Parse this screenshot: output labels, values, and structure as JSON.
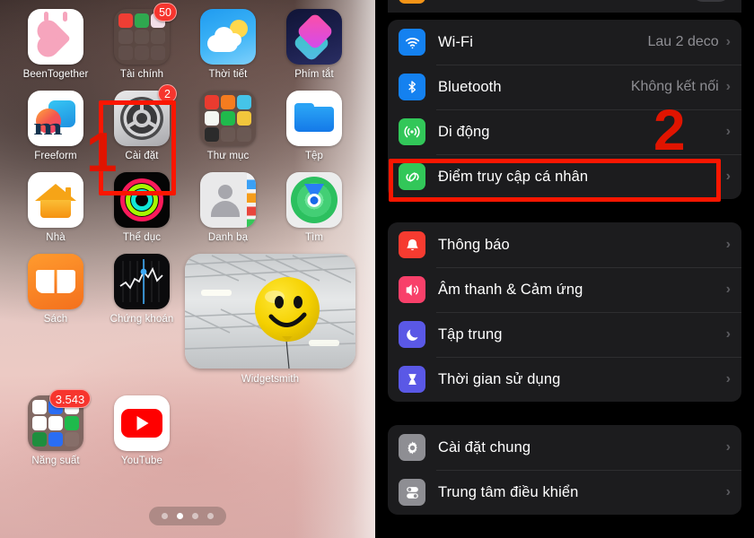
{
  "home_screen": {
    "page_dots": {
      "count": 4,
      "active_index": 1
    },
    "rows": [
      [
        {
          "label": "BeenTogether",
          "icon": "beentogether-icon",
          "badge": null
        },
        {
          "label": "Tài chính",
          "icon": "folder-finance-icon",
          "badge": "50"
        },
        {
          "label": "Thời tiết",
          "icon": "weather-icon",
          "badge": null
        },
        {
          "label": "Phím tắt",
          "icon": "shortcuts-icon",
          "badge": null
        }
      ],
      [
        {
          "label": "Freeform",
          "icon": "freeform-icon",
          "badge": null
        },
        {
          "label": "Cài đặt",
          "icon": "settings-gear-icon",
          "badge": "2"
        },
        {
          "label": "Thư mục",
          "icon": "folder-icon",
          "badge": null
        },
        {
          "label": "Tệp",
          "icon": "files-icon",
          "badge": null
        }
      ],
      [
        {
          "label": "Nhà",
          "icon": "home-app-icon",
          "badge": null
        },
        {
          "label": "Thể dục",
          "icon": "fitness-rings-icon",
          "badge": null
        },
        {
          "label": "Danh bạ",
          "icon": "contacts-icon",
          "badge": null
        },
        {
          "label": "Tìm",
          "icon": "find-my-icon",
          "badge": null
        }
      ],
      [
        {
          "label": "Sách",
          "icon": "books-icon",
          "badge": null
        },
        {
          "label": "Chứng khoán",
          "icon": "stocks-icon",
          "badge": null
        }
      ],
      [
        {
          "label": "Năng suất",
          "icon": "folder-productivity-icon",
          "badge": "3.543"
        },
        {
          "label": "YouTube",
          "icon": "youtube-icon",
          "badge": null
        }
      ]
    ],
    "widget": {
      "label": "Widgetsmith",
      "icon": "widgetsmith-photo-widget"
    }
  },
  "settings_screen": {
    "partial_top_row": {
      "label": "",
      "icon": "airplane-mode-icon",
      "toggle": "off"
    },
    "group1": [
      {
        "label": "Wi-Fi",
        "value": "Lau 2 deco",
        "icon": "wifi-icon",
        "chevron": "›",
        "highlighted": false
      },
      {
        "label": "Bluetooth",
        "value": "Không kết nối",
        "icon": "bluetooth-icon",
        "chevron": "›",
        "highlighted": false
      },
      {
        "label": "Di động",
        "value": "",
        "icon": "cellular-icon",
        "chevron": "›",
        "highlighted": false
      },
      {
        "label": "Điểm truy cập cá nhân",
        "value": "",
        "icon": "personal-hotspot-icon",
        "chevron": "›",
        "highlighted": true
      }
    ],
    "group2": [
      {
        "label": "Thông báo",
        "value": "",
        "icon": "notifications-bell-icon",
        "chevron": "›"
      },
      {
        "label": "Âm thanh & Cảm ứng",
        "value": "",
        "icon": "sounds-haptics-icon",
        "chevron": "›"
      },
      {
        "label": "Tập trung",
        "value": "",
        "icon": "focus-moon-icon",
        "chevron": "›"
      },
      {
        "label": "Thời gian sử dụng",
        "value": "",
        "icon": "screen-time-hourglass-icon",
        "chevron": "›"
      }
    ],
    "group3": [
      {
        "label": "Cài đặt chung",
        "value": "",
        "icon": "general-gear-icon",
        "chevron": "›"
      },
      {
        "label": "Trung tâm điều khiển",
        "value": "",
        "icon": "control-center-icon",
        "chevron": "›"
      }
    ]
  },
  "annotations": {
    "step_one": "1",
    "step_two": "2",
    "accent_color": "#fb1600"
  }
}
